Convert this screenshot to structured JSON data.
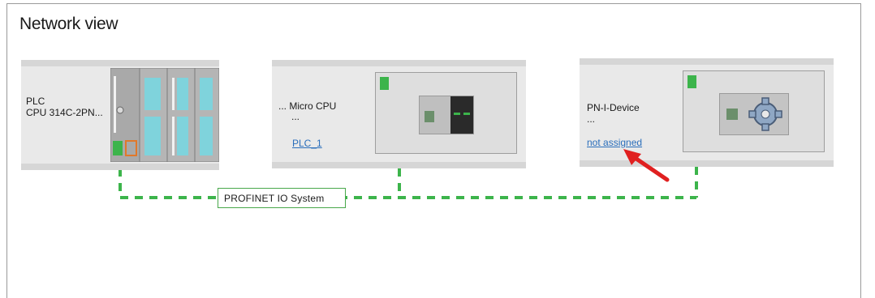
{
  "view": {
    "title": "Network view"
  },
  "devices": [
    {
      "name": "PLC",
      "type": "CPU 314C-2PN...",
      "status_color": "#3cb44b"
    },
    {
      "name": "... Micro CPU",
      "type": "...",
      "link": "PLC_1",
      "status_color": "#3cb44b"
    },
    {
      "name": "PN-I-Device",
      "type": "...",
      "link": "not assigned",
      "status_color": "#3cb44b"
    }
  ],
  "network": {
    "label": "PROFINET IO System",
    "color": "#3cb44b"
  },
  "annotation": {
    "arrow_color": "#e02020",
    "icon": "arrow-icon"
  }
}
